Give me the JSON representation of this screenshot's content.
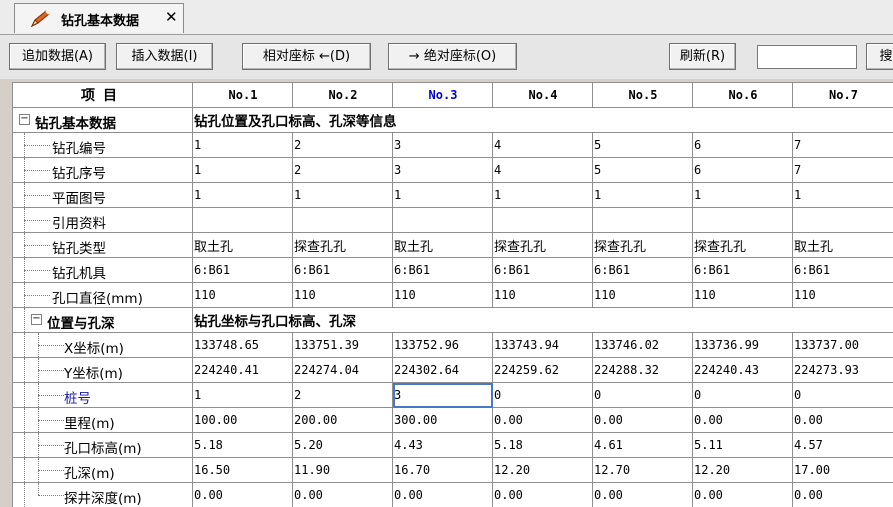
{
  "tab": {
    "title": "钻孔基本数据",
    "close": "✕",
    "icon": "pen-icon"
  },
  "toolbar": {
    "append": "追加数据(A)",
    "insert": "插入数据(I)",
    "relative": "相对座标 ←(D)",
    "absolute": "→ 绝对座标(O)",
    "refresh": "刷新(R)",
    "search_value": "",
    "search_btn": "搜"
  },
  "grid": {
    "corner": "项目",
    "columns": [
      "No.1",
      "No.2",
      "No.3",
      "No.4",
      "No.5",
      "No.6",
      "No.7"
    ],
    "selected_column": 2,
    "rows": [
      {
        "label": "钻孔基本数据",
        "type": "section",
        "level": 0,
        "desc": "钻孔位置及孔口标高、孔深等信息"
      },
      {
        "label": "钻孔编号",
        "level": 1,
        "values": [
          "1",
          "2",
          "3",
          "4",
          "5",
          "6",
          "7"
        ]
      },
      {
        "label": "钻孔序号",
        "level": 1,
        "values": [
          "1",
          "2",
          "3",
          "4",
          "5",
          "6",
          "7"
        ]
      },
      {
        "label": "平面图号",
        "level": 1,
        "values": [
          "1",
          "1",
          "1",
          "1",
          "1",
          "1",
          "1"
        ]
      },
      {
        "label": "引用资料",
        "level": 1,
        "values": [
          "",
          "",
          "",
          "",
          "",
          "",
          ""
        ]
      },
      {
        "label": "钻孔类型",
        "level": 1,
        "text": true,
        "values": [
          "取土孔",
          "探查孔孔",
          "取土孔",
          "探查孔孔",
          "探查孔孔",
          "探查孔孔",
          "取土孔"
        ]
      },
      {
        "label": "钻孔机具",
        "level": 1,
        "values": [
          "6:B61",
          "6:B61",
          "6:B61",
          "6:B61",
          "6:B61",
          "6:B61",
          "6:B61"
        ]
      },
      {
        "label": "孔口直径(mm)",
        "level": 1,
        "values": [
          "110",
          "110",
          "110",
          "110",
          "110",
          "110",
          "110"
        ]
      },
      {
        "label": "位置与孔深",
        "type": "section",
        "level": 1,
        "desc": "钻孔坐标与孔口标高、孔深"
      },
      {
        "label": "X坐标(m)",
        "level": 2,
        "values": [
          "133748.65",
          "133751.39",
          "133752.96",
          "133743.94",
          "133746.02",
          "133736.99",
          "133737.00"
        ]
      },
      {
        "label": "Y坐标(m)",
        "level": 2,
        "values": [
          "224240.41",
          "224274.04",
          "224302.64",
          "224259.62",
          "224288.32",
          "224240.43",
          "224273.93"
        ]
      },
      {
        "label": "桩号",
        "level": 2,
        "blue": true,
        "values": [
          "1",
          "2",
          "3",
          "0",
          "0",
          "0",
          "0"
        ]
      },
      {
        "label": "里程(m)",
        "level": 2,
        "values": [
          "100.00",
          "200.00",
          "300.00",
          "0.00",
          "0.00",
          "0.00",
          "0.00"
        ]
      },
      {
        "label": "孔口标高(m)",
        "level": 2,
        "values": [
          "5.18",
          "5.20",
          "4.43",
          "5.18",
          "4.61",
          "5.11",
          "4.57"
        ]
      },
      {
        "label": "孔深(m)",
        "level": 2,
        "values": [
          "16.50",
          "11.90",
          "16.70",
          "12.20",
          "12.70",
          "12.20",
          "17.00"
        ]
      },
      {
        "label": "探井深度(m)",
        "level": 2,
        "last": true,
        "values": [
          "0.00",
          "0.00",
          "0.00",
          "0.00",
          "0.00",
          "0.00",
          "0.00"
        ]
      }
    ],
    "current_cell": {
      "row": 11,
      "col": 2
    }
  }
}
